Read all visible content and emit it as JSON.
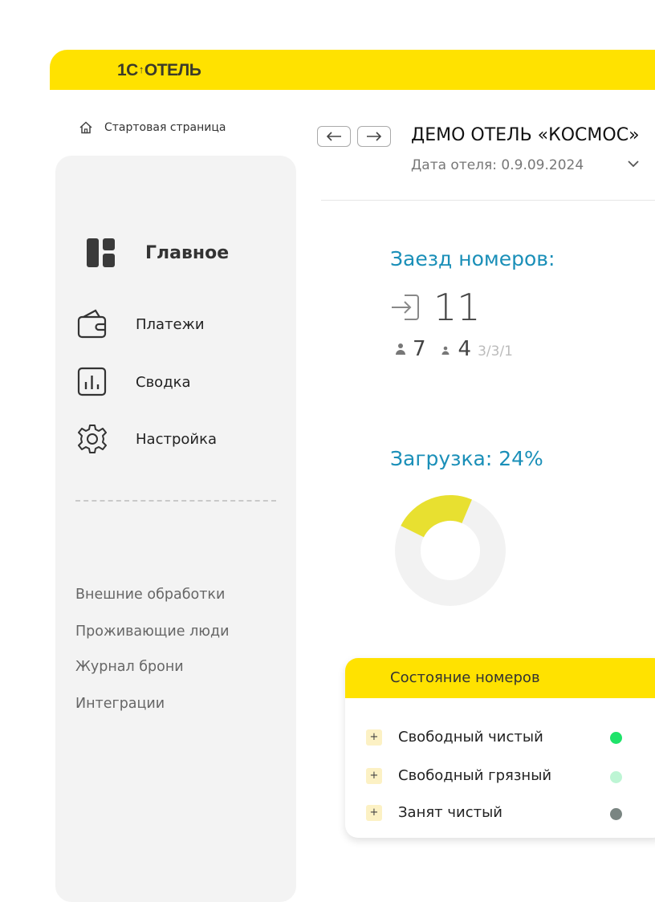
{
  "header": {
    "logo_text": "1C",
    "logo_suffix": "ОТЕЛЬ",
    "accent": "#ffe200"
  },
  "breadcrumb": {
    "home_label": "Стартовая страница"
  },
  "sidebar": {
    "main_item": "Главное",
    "items": [
      {
        "label": "Платежи",
        "icon": "wallet-icon"
      },
      {
        "label": "Сводка",
        "icon": "chart-icon"
      },
      {
        "label": "Настройка",
        "icon": "gear-icon"
      }
    ],
    "extra_links": [
      "Внешние обработки",
      "Проживающие люди",
      "Журнал брони",
      "Интеграции"
    ]
  },
  "hotel": {
    "title": "ДЕМО ОТЕЛЬ «КОСМОС»",
    "date_label": "Дата отеля: 0.9.09.2024"
  },
  "checkin": {
    "title": "Заезд номеров:",
    "count": "11",
    "adults": "7",
    "children": "4",
    "breakdown": "3/3/1"
  },
  "occupancy": {
    "title": "Загрузка: 24%",
    "percent": 24,
    "fill_color": "#e8e030",
    "track_color": "#f2f2f2"
  },
  "room_status": {
    "title": "Состояние номеров",
    "rows": [
      {
        "label": "Свободный чистый",
        "color": "#1ee36a"
      },
      {
        "label": "Свободный грязный",
        "color": "#bdf5d4"
      },
      {
        "label": "Занят чистый",
        "color": "#7a8582"
      }
    ]
  }
}
